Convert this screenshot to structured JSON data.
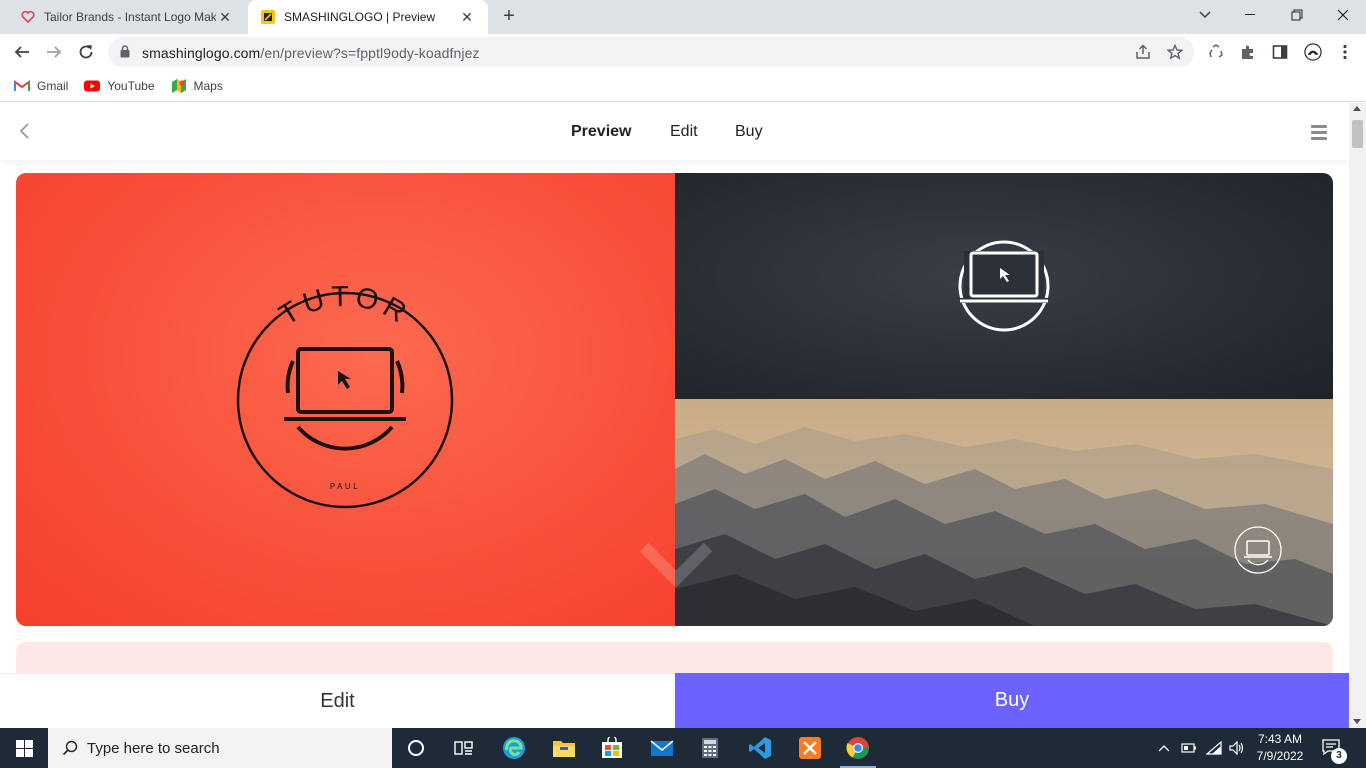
{
  "browser": {
    "tabs": [
      {
        "title": "Tailor Brands - Instant Logo Mak",
        "close": "✕",
        "active": false,
        "favicon": "tailor-brands-heart-icon"
      },
      {
        "title": "SMASHINGLOGO | Preview",
        "close": "✕",
        "active": true,
        "favicon": "smashinglogo-icon"
      }
    ],
    "new_tab": "+",
    "window_controls": {
      "dropdown": "⌄",
      "minimize": "—",
      "restore": "❐",
      "close": "✕"
    },
    "url_host": "smashinglogo.com",
    "url_path": "/en/preview?s=fpptl9ody-koadfnjez",
    "bookmarks": [
      {
        "label": "Gmail",
        "icon": "gmail-icon"
      },
      {
        "label": "YouTube",
        "icon": "youtube-icon"
      },
      {
        "label": "Maps",
        "icon": "maps-icon"
      }
    ]
  },
  "site": {
    "nav": {
      "preview": "Preview",
      "edit": "Edit",
      "buy": "Buy"
    },
    "logo": {
      "top_text": "TUTOR",
      "bottom_text": "PAUL"
    },
    "colors": {
      "red_panel": "#f9503a",
      "dark_panel": "#2a2e35",
      "buy_button": "#6c63ff",
      "second_card": "#fde8e6"
    },
    "bottom_bar": {
      "edit": "Edit",
      "buy": "Buy"
    }
  },
  "taskbar": {
    "search_placeholder": "Type here to search",
    "time": "7:43 AM",
    "date": "7/9/2022",
    "notifications": "3",
    "pinned": [
      "task-view-icon",
      "taskview-icon",
      "edge-icon",
      "file-explorer-icon",
      "store-icon",
      "mail-icon",
      "calculator-icon",
      "vscode-icon",
      "xampp-icon",
      "chrome-icon"
    ]
  }
}
